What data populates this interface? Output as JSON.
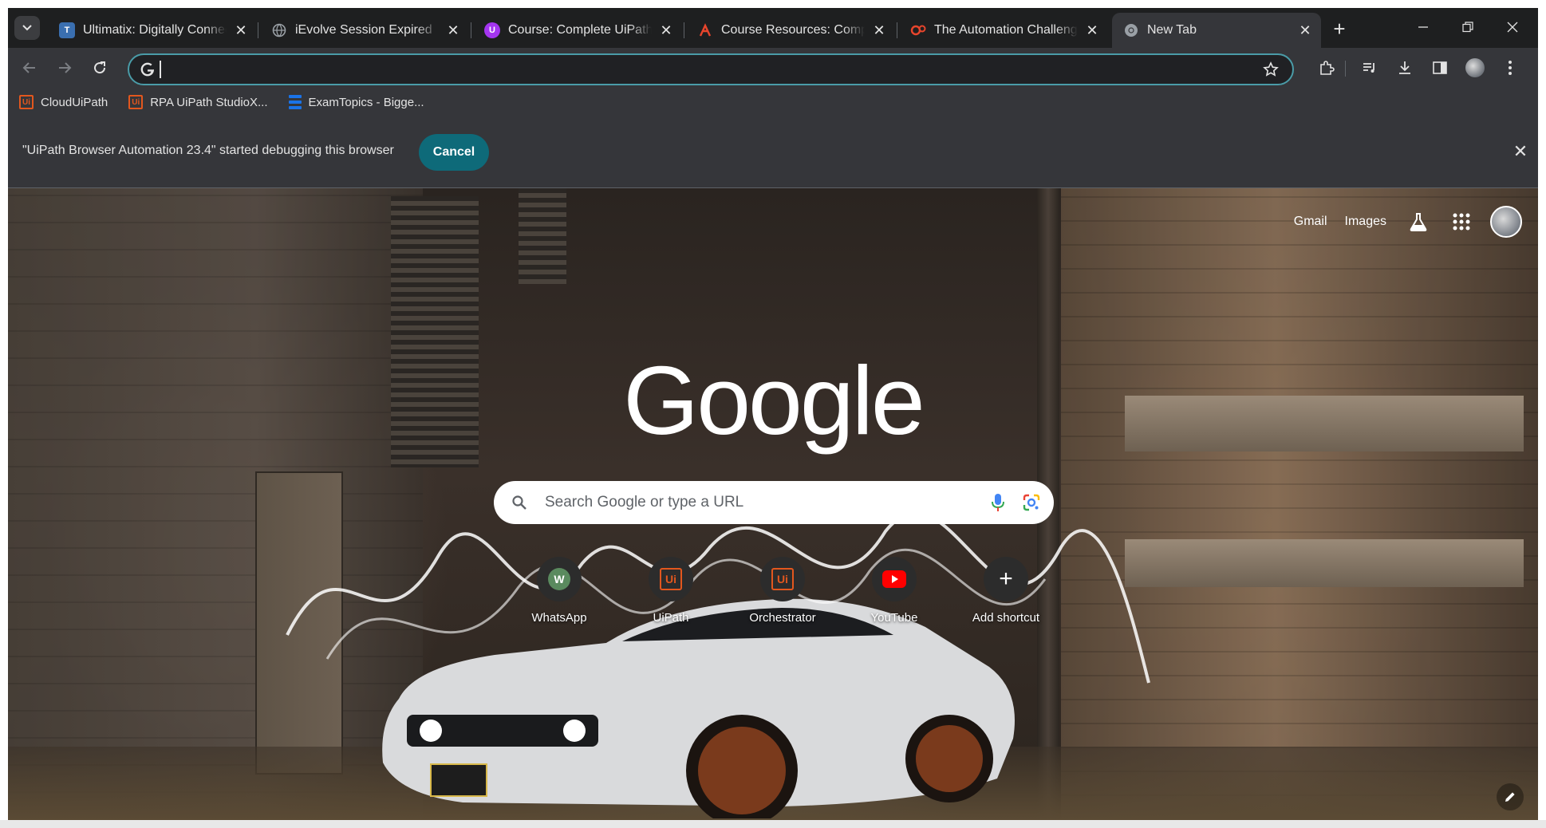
{
  "tabs": [
    {
      "title": "Ultimatix: Digitally Connect",
      "favicon": "tata-icon",
      "color": "#3a6fb0"
    },
    {
      "title": "iEvolve Session Expired",
      "favicon": "globe-icon",
      "color": "#9aa0a6"
    },
    {
      "title": "Course: Complete UiPath R",
      "favicon": "udemy-icon",
      "color": "#a435f0"
    },
    {
      "title": "Course Resources: Complet",
      "favicon": "course-icon",
      "color": "#e8452c"
    },
    {
      "title": "The Automation Challenge",
      "favicon": "gear-red-icon",
      "color": "#e8452c"
    },
    {
      "title": "New Tab",
      "favicon": "chrome-icon",
      "color": "#9aa0a6"
    }
  ],
  "omnibox": {
    "value": "",
    "placeholder": ""
  },
  "bookmarks": [
    {
      "label": "CloudUiPath",
      "icon": "uipath-icon"
    },
    {
      "label": "RPA UiPath StudioX...",
      "icon": "uipath-icon"
    },
    {
      "label": "ExamTopics - Bigge...",
      "icon": "examtopics-icon"
    }
  ],
  "infobar": {
    "message": "\"UiPath Browser Automation 23.4\" started debugging this browser",
    "cancel_label": "Cancel"
  },
  "ntp": {
    "links": {
      "gmail": "Gmail",
      "images": "Images"
    },
    "logo": "Google",
    "search_placeholder": "Search Google or type a URL",
    "shortcuts": [
      {
        "label": "WhatsApp",
        "icon_text": "W"
      },
      {
        "label": "UiPath",
        "icon_text": "Ui"
      },
      {
        "label": "Orchestrator",
        "icon_text": "Ui"
      },
      {
        "label": "YouTube",
        "icon_text": ""
      },
      {
        "label": "Add shortcut",
        "icon_text": "+"
      }
    ]
  },
  "colors": {
    "accent": "#0e6a79",
    "omnibox_border": "#4a9ca8",
    "uipath": "#e2571e"
  }
}
